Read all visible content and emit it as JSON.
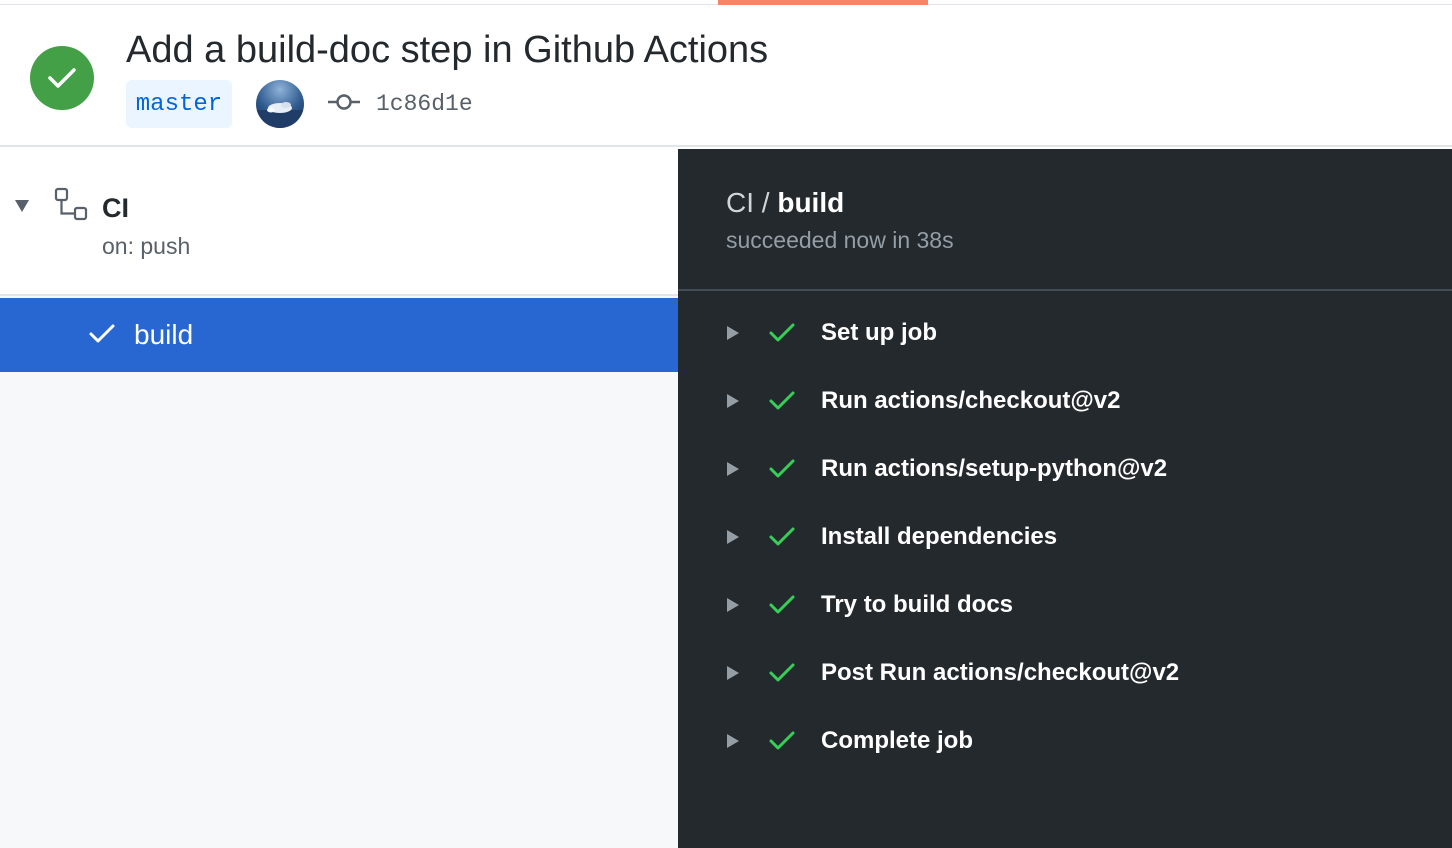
{
  "run": {
    "title": "Add a build-doc step in Github Actions",
    "status": "success",
    "branch": "master",
    "commit_sha": "1c86d1e",
    "colors": {
      "success": "#43a047",
      "accent": "#f9826c",
      "selected": "#2866d1",
      "branch_bg": "#eaf5ff",
      "branch_text": "#0366d6"
    }
  },
  "sidebar": {
    "workflow": {
      "name": "CI",
      "trigger": "on: push"
    },
    "jobs": [
      {
        "label": "build",
        "status": "success",
        "selected": true
      }
    ]
  },
  "log": {
    "workflow": "CI",
    "separator": " / ",
    "job": "build",
    "status_text": "succeeded now in 38s",
    "steps": [
      {
        "label": "Set up job",
        "status": "success"
      },
      {
        "label": "Run actions/checkout@v2",
        "status": "success"
      },
      {
        "label": "Run actions/setup-python@v2",
        "status": "success"
      },
      {
        "label": "Install dependencies",
        "status": "success"
      },
      {
        "label": "Try to build docs",
        "status": "success"
      },
      {
        "label": "Post Run actions/checkout@v2",
        "status": "success"
      },
      {
        "label": "Complete job",
        "status": "success"
      }
    ]
  },
  "icons": {
    "status": "check-circle-icon",
    "commit": "git-commit-icon",
    "workflow": "workflow-icon",
    "collapse": "triangle-down-icon",
    "expand": "triangle-right-icon",
    "step_status": "check-icon"
  }
}
